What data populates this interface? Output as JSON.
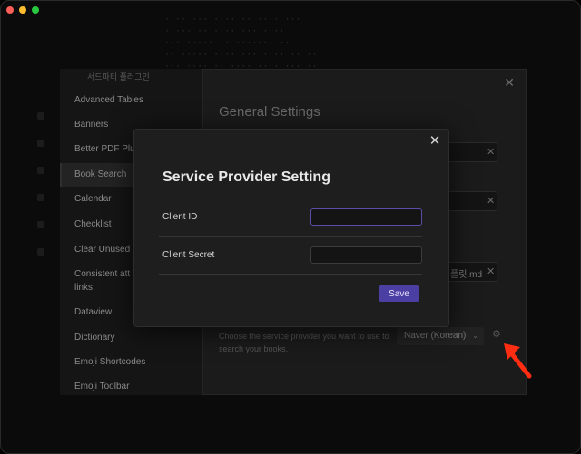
{
  "background_editor_lines": [
    "· ·· ··· ···· ·· ···· ···",
    "· ··· ·· ···· ··· ····",
    "··· ····· ·· ······· ··",
    "·· ····· ···· ··· ···· ·· ··",
    "··· ···· ·· ···· ···· ··· ··"
  ],
  "sidebar": {
    "header_left": "",
    "header": "서드파티 플러그인",
    "items": [
      {
        "label": "Advanced Tables"
      },
      {
        "label": "Banners"
      },
      {
        "label": "Better PDF Plu"
      },
      {
        "label": "Book Search",
        "active": true
      },
      {
        "label": "Calendar"
      },
      {
        "label": "Checklist"
      },
      {
        "label": "Clear Unused I"
      },
      {
        "label": "Consistent att"
      },
      {
        "label": "links"
      },
      {
        "label": "Dataview"
      },
      {
        "label": "Dictionary"
      },
      {
        "label": "Emoji Shortcodes"
      },
      {
        "label": "Emoji Toolbar"
      }
    ]
  },
  "settings_panel": {
    "title": "General Settings",
    "close_glyph": "✕",
    "field_value": "플릿.md",
    "description": "Choose the service provider you want to use to search your books.",
    "provider_selected": "Naver (Korean)"
  },
  "modal": {
    "title": "Service Provider Setting",
    "close_glyph": "✕",
    "client_id": {
      "label": "Client ID",
      "value": ""
    },
    "client_secret": {
      "label": "Client Secret",
      "value": ""
    },
    "save_label": "Save"
  },
  "colors": {
    "accent": "#4b3fa3",
    "annotation_arrow": "#ff2d12"
  }
}
